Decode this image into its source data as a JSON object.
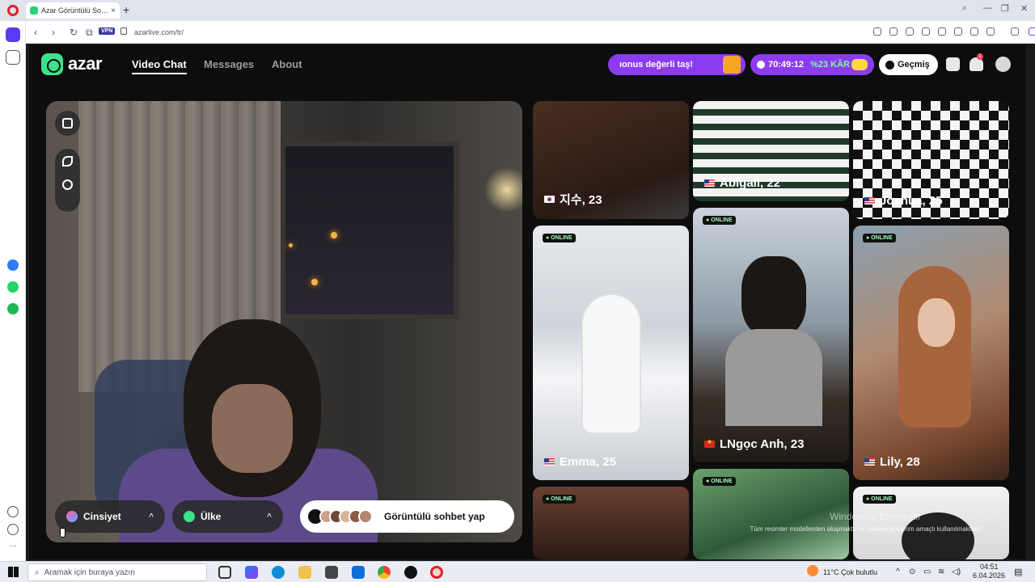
{
  "browser": {
    "tab_title": "Azar Görüntülü Sohbet &",
    "tab_close": "×",
    "new_tab": "+",
    "url": "azarlive.com/tr/",
    "vpn_label": "VPN"
  },
  "app": {
    "logo_text": "azar",
    "nav": {
      "video_chat": "Video Chat",
      "messages": "Messages",
      "about": "About"
    },
    "promo_text": "ıonus değerli taş!",
    "timer": "70:49:12",
    "profit": "%23 KÂR",
    "history_label": "Geçmiş",
    "notification_count": "1"
  },
  "video_panel": {
    "gender_filter": "Cinsiyet",
    "country_filter": "Ülke",
    "chevron": "^",
    "cta_label": "Görüntülü sohbet yap"
  },
  "profiles": [
    {
      "name": "지수, 23",
      "flag": "kr",
      "online": false
    },
    {
      "name": "Abigail, 22",
      "flag": "us",
      "online": false
    },
    {
      "name": "Joshua, 25",
      "flag": "us",
      "online": false
    },
    {
      "name": "Emma, 25",
      "flag": "us",
      "online": true
    },
    {
      "name": "LNgọc Anh, 23",
      "flag": "vn",
      "online": true
    },
    {
      "name": "Lily, 28",
      "flag": "us",
      "online": true
    },
    {
      "name": "",
      "flag": "",
      "online": true
    },
    {
      "name": "",
      "flag": "",
      "online": true
    },
    {
      "name": "",
      "flag": "",
      "online": true
    }
  ],
  "online_label": "● ONLINE",
  "overlay": {
    "watermark": "Windows'u Etkinleştir",
    "disclaimer": "Tüm resimler modellerden oluşmakta ve sadece gösterim amaçlı kullanılmaktadır."
  },
  "taskbar": {
    "search_placeholder": "Aramak için buraya yazın",
    "weather": "11°C  Çok bulutlu",
    "time": "04:51",
    "date": "6.04.2026"
  },
  "colors": {
    "brand_green": "#3ee08a",
    "promo_purple": "#8b3cf0",
    "app_bg": "#0d0d0d"
  }
}
